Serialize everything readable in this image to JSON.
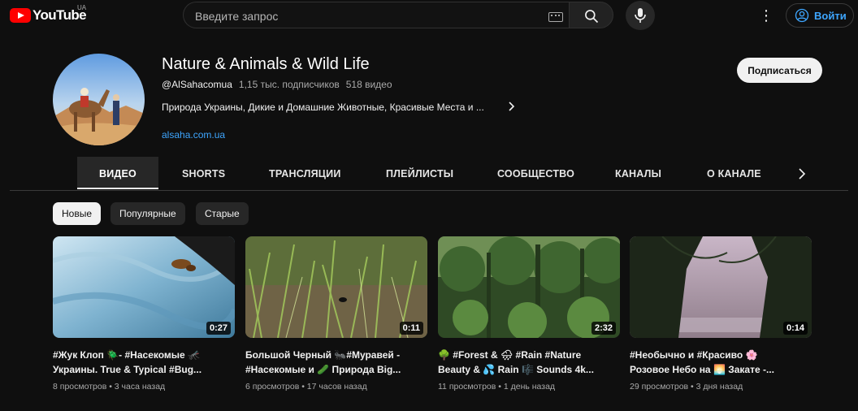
{
  "masthead": {
    "logo_text": "YouTube",
    "country_code": "UA",
    "search_placeholder": "Введите запрос",
    "login_label": "Войти",
    "icons": [
      "youtube-logo-icon",
      "keyboard-icon",
      "search-icon",
      "mic-icon",
      "more-vert-icon",
      "account-circle-icon"
    ]
  },
  "channel": {
    "title": "Nature & Animals & Wild Life",
    "handle": "@AlSahacomua",
    "subscribers": "1,15 тыс. подписчиков",
    "videos_count": "518 видео",
    "description": "Природа Украины, Дикие и Домашние Животные, Красивые Места и ...",
    "link": "alsaha.com.ua",
    "subscribe_label": "Подписаться"
  },
  "tabs": [
    {
      "label": "ВИДЕО",
      "active": true
    },
    {
      "label": "SHORTS"
    },
    {
      "label": "ТРАНСЛЯЦИИ"
    },
    {
      "label": "ПЛЕЙЛИСТЫ"
    },
    {
      "label": "СООБЩЕСТВО"
    },
    {
      "label": "КАНАЛЫ"
    },
    {
      "label": "О КАНАЛЕ"
    }
  ],
  "chips": [
    {
      "label": "Новые",
      "active": true
    },
    {
      "label": "Популярные"
    },
    {
      "label": "Старые"
    }
  ],
  "videos": [
    {
      "duration": "0:27",
      "title_line1": "#Жук Клоп 🪲- #Насекомые 🦟",
      "title_line2": "Украины. True & Typical #Bug...",
      "views": "8 просмотров",
      "age": "3 часа назад"
    },
    {
      "duration": "0:11",
      "title_line1": "Большой Черный 🐜#Муравей -",
      "title_line2": "#Насекомые и 🥒 Природа Big...",
      "views": "6 просмотров",
      "age": "17 часов назад"
    },
    {
      "duration": "2:32",
      "title_line1": "🌳 #Forest & 🌧 #Rain #Nature",
      "title_line2": "Beauty & 💦 Rain 🎼 Sounds 4k...",
      "views": "11 просмотров",
      "age": "1 день назад"
    },
    {
      "duration": "0:14",
      "title_line1": "#Необычно и #Красиво 🌸",
      "title_line2": "Розовое Небо на 🌅 Закате -...",
      "views": "29 просмотров",
      "age": "3 дня назад"
    }
  ],
  "colors": {
    "background": "#0f0f0f",
    "brand_red": "#ff0000",
    "link_blue": "#3ea6ff",
    "secondary_text": "#aaaaaa"
  }
}
